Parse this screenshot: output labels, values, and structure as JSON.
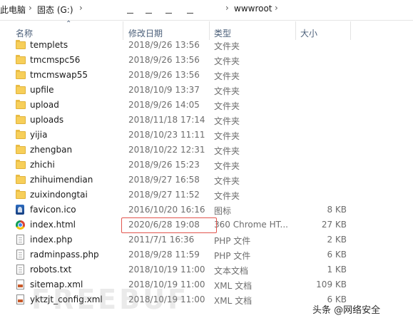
{
  "breadcrumb": {
    "this_pc": "此电脑",
    "drive": "固态 (G:)",
    "folder": "wwwroot",
    "separator": "›"
  },
  "columns": {
    "name": "名称",
    "date": "修改日期",
    "type": "类型",
    "size": "大小"
  },
  "files": [
    {
      "name": "templets",
      "date": "2018/9/26 13:56",
      "type": "文件夹",
      "size": "",
      "icon": "folder-icon"
    },
    {
      "name": "tmcmspc56",
      "date": "2018/9/26 13:56",
      "type": "文件夹",
      "size": "",
      "icon": "folder-icon"
    },
    {
      "name": "tmcmswap55",
      "date": "2018/9/26 13:56",
      "type": "文件夹",
      "size": "",
      "icon": "folder-icon"
    },
    {
      "name": "upfile",
      "date": "2018/10/9 13:37",
      "type": "文件夹",
      "size": "",
      "icon": "folder-icon"
    },
    {
      "name": "upload",
      "date": "2018/9/26 14:05",
      "type": "文件夹",
      "size": "",
      "icon": "folder-icon"
    },
    {
      "name": "uploads",
      "date": "2018/11/18 17:14",
      "type": "文件夹",
      "size": "",
      "icon": "folder-icon"
    },
    {
      "name": "yijia",
      "date": "2018/10/23 11:11",
      "type": "文件夹",
      "size": "",
      "icon": "folder-icon"
    },
    {
      "name": "zhengban",
      "date": "2018/10/22 12:31",
      "type": "文件夹",
      "size": "",
      "icon": "folder-icon"
    },
    {
      "name": "zhichi",
      "date": "2018/9/26 15:23",
      "type": "文件夹",
      "size": "",
      "icon": "folder-icon"
    },
    {
      "name": "zhihuimendian",
      "date": "2018/9/27 16:58",
      "type": "文件夹",
      "size": "",
      "icon": "folder-icon"
    },
    {
      "name": "zuixindongtai",
      "date": "2018/9/27 11:52",
      "type": "文件夹",
      "size": "",
      "icon": "folder-icon"
    },
    {
      "name": "favicon.ico",
      "date": "2016/10/20 16:16",
      "type": "图标",
      "size": "8 KB",
      "icon": "favicon-icon"
    },
    {
      "name": "index.html",
      "date": "2020/6/28 19:08",
      "type": "360 Chrome HT...",
      "size": "27 KB",
      "icon": "chrome-html-icon"
    },
    {
      "name": "index.php",
      "date": "2011/7/1 16:36",
      "type": "PHP 文件",
      "size": "2 KB",
      "icon": "document-icon"
    },
    {
      "name": "radminpass.php",
      "date": "2018/9/28 11:59",
      "type": "PHP 文件",
      "size": "6 KB",
      "icon": "document-icon"
    },
    {
      "name": "robots.txt",
      "date": "2018/10/19 11:00",
      "type": "文本文档",
      "size": "1 KB",
      "icon": "document-icon"
    },
    {
      "name": "sitemap.xml",
      "date": "2018/10/19 11:00",
      "type": "XML 文档",
      "size": "109 KB",
      "icon": "xml-icon"
    },
    {
      "name": "yktzjt_config.xml",
      "date": "2018/10/19 11:00",
      "type": "XML 文档",
      "size": "6 KB",
      "icon": "xml-icon"
    }
  ],
  "watermarks": {
    "left": "FREEBUF",
    "right": "头条 @网络安全"
  },
  "colors": {
    "header_text": "#4c607a",
    "highlight_border": "#e2554e",
    "folder": "#f7cf5a"
  }
}
